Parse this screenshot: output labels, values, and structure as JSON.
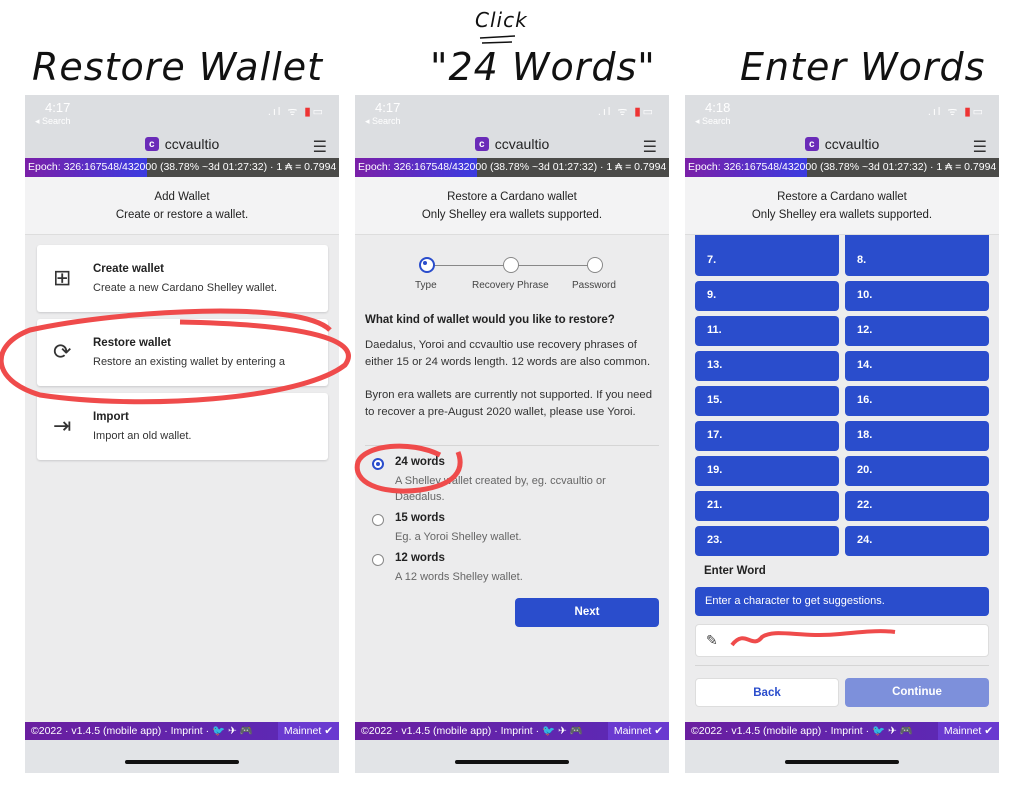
{
  "annotations": {
    "title1": "Restore Wallet",
    "title2": "\"24 Words\"",
    "click": "Click",
    "title3": "Enter Words"
  },
  "common": {
    "times": [
      "4:17",
      "4:17",
      "4:18"
    ],
    "back_label": "◂ Search",
    "brand": "ccvaultio",
    "epoch": {
      "text": "Epoch: 326:167548/432000 (38.78% ~3d 01:27:32) · 1 ₳ = 0.7994",
      "progress_percent": 38.78
    },
    "footer": "©2022 · v1.4.5 (mobile app) · Imprint · 🐦 ✈ 🎮",
    "network": "Mainnet ✔",
    "colors": {
      "accent": "#2a4dcc",
      "brand": "#6a2bb8",
      "annotation": "#ef4b4b"
    }
  },
  "screen1": {
    "title": "Add Wallet",
    "subtitle": "Create or restore a wallet.",
    "cards": [
      {
        "icon": "wallet-add-icon",
        "glyph": "⊞",
        "title": "Create wallet",
        "desc": "Create a new Cardano Shelley wallet."
      },
      {
        "icon": "sync-icon",
        "glyph": "⟳",
        "title": "Restore wallet",
        "desc": "Restore an existing wallet by entering a"
      },
      {
        "icon": "import-icon",
        "glyph": "⇥",
        "title": "Import",
        "desc": "Import an old wallet."
      }
    ]
  },
  "screen2": {
    "title": "Restore a Cardano wallet",
    "subtitle": "Only Shelley era wallets supported.",
    "steps": [
      "Type",
      "Recovery Phrase",
      "Password"
    ],
    "question": "What kind of wallet would you like to restore?",
    "p1": "Daedalus, Yoroi and ccvaultio use recovery phrases of either 15 or 24 words length. 12 words are also common.",
    "p2": "Byron era wallets are currently not supported. If you need to recover a pre-August 2020 wallet, please use Yoroi.",
    "options": [
      {
        "label": "24 words",
        "desc": "A Shelley wallet created by, eg. ccvaultio or Daedalus.",
        "selected": true
      },
      {
        "label": "15 words",
        "desc": "Eg. a Yoroi Shelley wallet.",
        "selected": false
      },
      {
        "label": "12 words",
        "desc": "A 12 words Shelley wallet.",
        "selected": false
      }
    ],
    "next": "Next"
  },
  "screen3": {
    "title": "Restore a Cardano wallet",
    "subtitle": "Only Shelley era wallets supported.",
    "words": [
      "7.",
      "8.",
      "9.",
      "10.",
      "11.",
      "12.",
      "13.",
      "14.",
      "15.",
      "16.",
      "17.",
      "18.",
      "19.",
      "20.",
      "21.",
      "22.",
      "23.",
      "24."
    ],
    "enter_word": "Enter Word",
    "suggestion": "Enter a character to get suggestions.",
    "input_value": "",
    "back": "Back",
    "continue": "Continue"
  }
}
